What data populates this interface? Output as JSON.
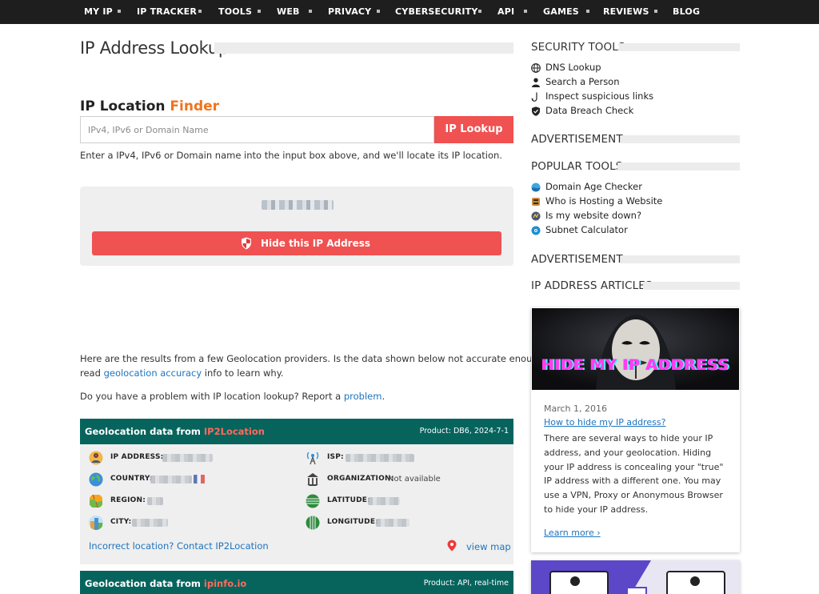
{
  "nav": {
    "items": [
      "MY IP",
      "IP TRACKER",
      "TOOLS",
      "WEB",
      "PRIVACY",
      "CYBERSECURITY",
      "API",
      "GAMES",
      "REVIEWS",
      "BLOG"
    ]
  },
  "main": {
    "title": "IP Address Lookup",
    "finder_title": "IP Location",
    "finder_accent": "Finder",
    "search": {
      "placeholder": "IPv4, IPv6 or Domain Name",
      "value": "",
      "button": "IP Lookup"
    },
    "help_text": "Enter a IPv4, IPv6 or Domain name into the input box above, and we'll locate its IP location.",
    "hide_button": "Hide this IP Address",
    "results_intro_1": "Here are the results from a few Geolocation providers. Is the data shown below not accurate enough? Please",
    "results_intro_2a": "read ",
    "results_intro_link": "geolocation accuracy",
    "results_intro_2b": " info to learn why.",
    "problem_text": "Do you have a problem with IP location lookup? Report a ",
    "problem_link": "problem",
    "problem_end": "."
  },
  "cards": [
    {
      "title_prefix": "Geolocation data from ",
      "provider": "IP2Location",
      "product": "Product: DB6, 2024-7-1",
      "fields": {
        "ip": "IP ADDRESS:",
        "country": "COUNTRY:",
        "region": "REGION:",
        "city": "CITY:",
        "isp": "ISP:",
        "organization": "ORGANIZATION:",
        "organization_value": "Not available",
        "latitude": "LATITUDE:",
        "longitude": "LONGITUDE:"
      },
      "incorrect_link": "Incorrect location? Contact IP2Location",
      "view_map": "view map"
    },
    {
      "title_prefix": "Geolocation data from ",
      "provider": "ipinfo.io",
      "product": "Product: API, real-time"
    }
  ],
  "sidebar": {
    "security_tools": {
      "heading": "SECURITY TOOLS",
      "items": [
        "DNS Lookup",
        "Search a Person",
        "Inspect suspicious links",
        "Data Breach Check"
      ]
    },
    "ad1": "ADVERTISEMENT",
    "popular_tools": {
      "heading": "POPULAR TOOLS",
      "items": [
        "Domain Age Checker",
        "Who is Hosting a Website",
        "Is my website down?",
        "Subnet Calculator"
      ]
    },
    "ad2": "ADVERTISEMENT",
    "articles": {
      "heading": "IP ADDRESS ARTICLES",
      "article": {
        "image_text": "HIDE MY IP ADDRESS",
        "date": "March 1, 2016",
        "title": "How to hide my IP address?",
        "body": "There are several ways to hide your IP address, and your geolocation. Hiding your IP address is concealing your \"true\" IP address with a different one. You may use a VPN, Proxy or Anonymous Browser to hide your IP address.",
        "more": "Learn more"
      }
    }
  },
  "colors": {
    "nav_bg": "#1e1e1e",
    "accent_orange": "#f0731f",
    "button_red": "#f05151",
    "card_header": "#06645d",
    "link_blue": "#1e73be"
  }
}
